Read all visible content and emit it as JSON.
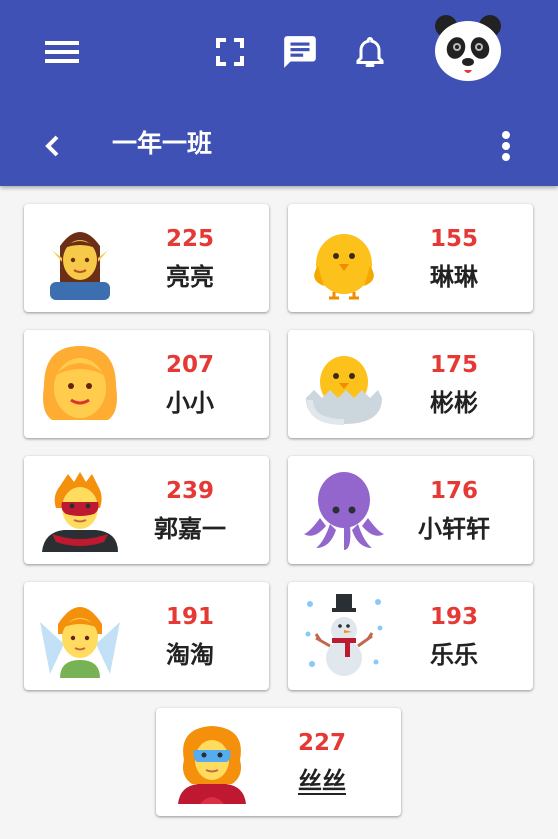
{
  "header": {
    "title": "一年一班",
    "icons": [
      "menu-icon",
      "fullscreen-icon",
      "message-icon",
      "bell-icon",
      "panda-avatar",
      "back-icon",
      "more-vert-icon"
    ],
    "color": "#3f51b5"
  },
  "students": [
    {
      "score": "225",
      "name": "亮亮",
      "avatar": "elf"
    },
    {
      "score": "155",
      "name": "琳琳",
      "avatar": "chick"
    },
    {
      "score": "207",
      "name": "小小",
      "avatar": "girl"
    },
    {
      "score": "175",
      "name": "彬彬",
      "avatar": "hatching-chick"
    },
    {
      "score": "239",
      "name": "郭嘉一",
      "avatar": "superhero"
    },
    {
      "score": "176",
      "name": "小轩轩",
      "avatar": "octopus"
    },
    {
      "score": "191",
      "name": "淘淘",
      "avatar": "fairy"
    },
    {
      "score": "193",
      "name": "乐乐",
      "avatar": "snowman"
    },
    {
      "score": "227",
      "name": "丝丝",
      "avatar": "superheroine"
    }
  ],
  "colors": {
    "score": "#e53935",
    "background": "#f5f5f5"
  }
}
